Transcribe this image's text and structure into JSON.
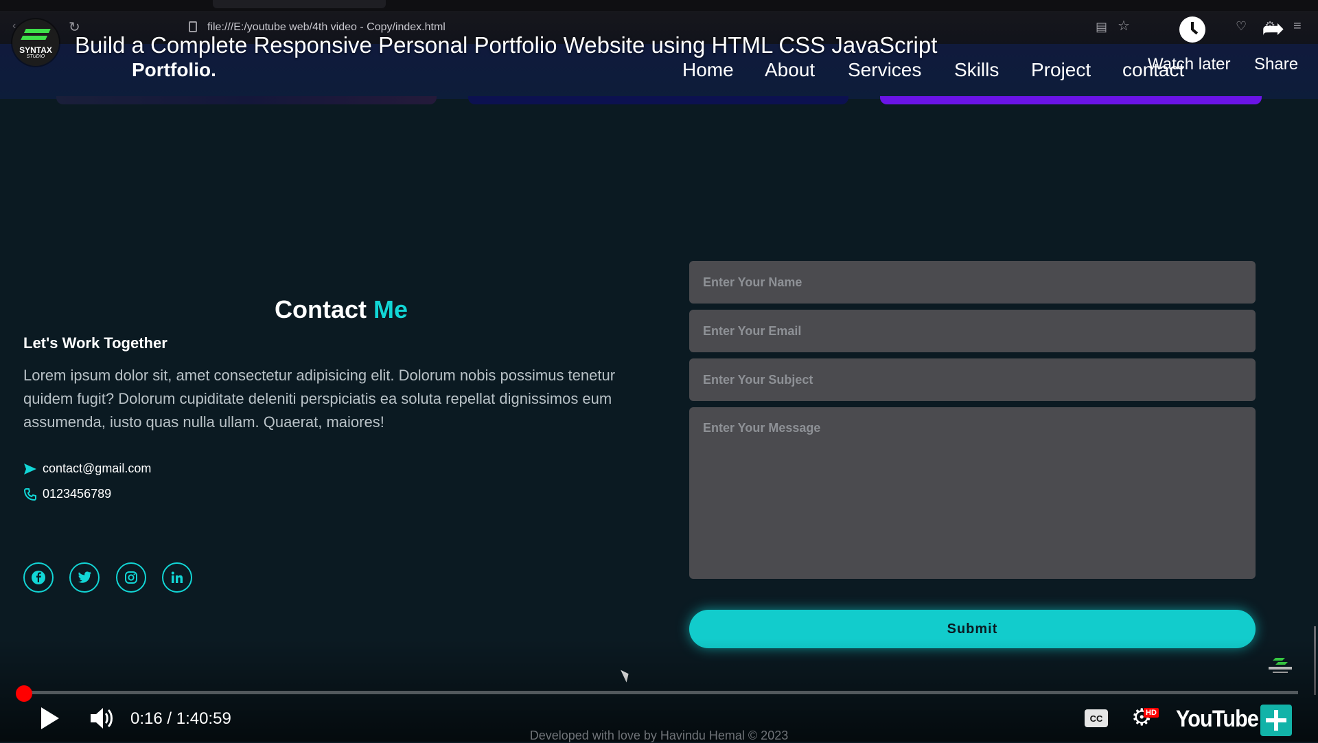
{
  "browser": {
    "url": "file:///E:/youtube web/4th video - Copy/index.html"
  },
  "video": {
    "title": "Build a Complete Responsive Personal Portfolio Website using HTML CSS JavaScript",
    "channel": {
      "name": "SYNTAX",
      "sub": "STUDIO"
    },
    "watch_later": "Watch later",
    "share": "Share"
  },
  "site": {
    "logo": "Portfolio.",
    "nav": [
      "Home",
      "About",
      "Services",
      "Skills",
      "Project",
      "contact"
    ]
  },
  "contact": {
    "heading_plain": "Contact ",
    "heading_accent": "Me",
    "subheading": "Let's Work Together",
    "paragraph": "Lorem ipsum dolor sit, amet consectetur adipisicing elit. Dolorum nobis possimus tenetur quidem fugit? Dolorum cupiditate deleniti perspiciatis ea soluta repellat dignissimos eum assumenda, iusto quas nulla ullam. Quaerat, maiores!",
    "email": "contact@gmail.com",
    "phone": "0123456789",
    "social": [
      "facebook-icon",
      "twitter-icon",
      "instagram-icon",
      "linkedin-icon"
    ]
  },
  "form": {
    "name_placeholder": "Enter Your Name",
    "email_placeholder": "Enter Your Email",
    "subject_placeholder": "Enter Your Subject",
    "message_placeholder": "Enter Your Message",
    "submit": "Submit"
  },
  "footer": "Developed with love by Havindu Hemal © 2023",
  "player": {
    "time": "0:16 / 1:40:59",
    "progress": 0.0026,
    "cc": "CC",
    "hd": "HD",
    "logo": "YouTube"
  },
  "colors": {
    "accent": "#12d6d6",
    "background": "#0b1a22",
    "progress": "#ff0000"
  }
}
